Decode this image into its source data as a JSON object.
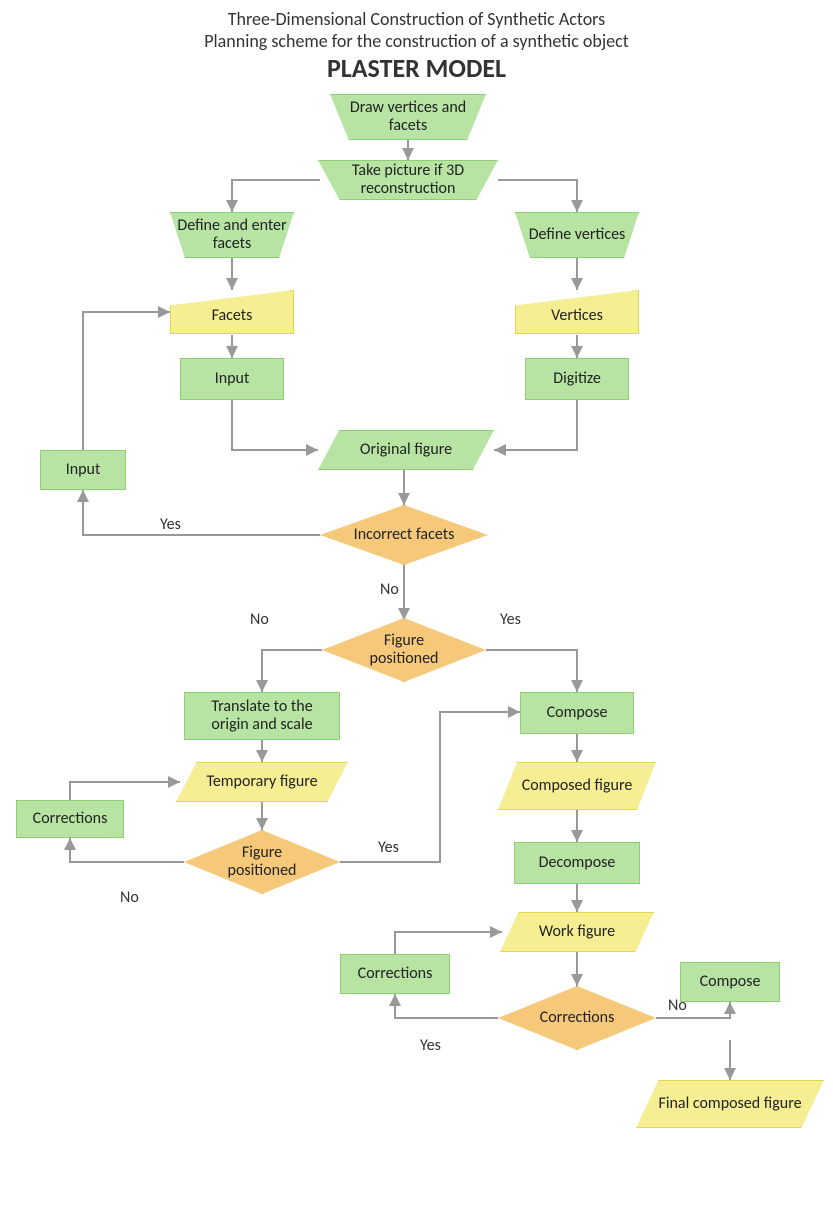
{
  "titles": {
    "line1": "Three-Dimensional Construction of Synthetic Actors",
    "line2": "Planning scheme for the construction of a synthetic object",
    "main": "PLASTER MODEL"
  },
  "nodes": {
    "draw": "Draw vertices and facets",
    "takepic": "Take picture if 3D reconstruction",
    "deffacets": "Define and enter facets",
    "defverts": "Define vertices",
    "facets": "Facets",
    "vertices": "Vertices",
    "inputL": "Input",
    "digitize": "Digitize",
    "inputLoop": "Input",
    "origfig": "Original figure",
    "incfacets": "Incorrect facets",
    "figpos1": "Figure positioned",
    "translate": "Translate to the origin and scale",
    "tempfig": "Temporary figure",
    "figpos2": "Figure positioned",
    "correctionsL": "Corrections",
    "compose1": "Compose",
    "compfig": "Composed figure",
    "decompose": "Decompose",
    "workfig": "Work figure",
    "correctionsR": "Corrections",
    "correctionsDec": "Corrections",
    "compose2": "Compose",
    "finalfig": "Final composed figure"
  },
  "labels": {
    "yes": "Yes",
    "no": "No"
  },
  "chart_data": {
    "type": "flowchart",
    "title": "PLASTER MODEL — Planning scheme for the construction of a synthetic object",
    "nodes": [
      {
        "id": "draw",
        "shape": "manual-op",
        "label": "Draw vertices and facets"
      },
      {
        "id": "takepic",
        "shape": "manual-op",
        "label": "Take picture if 3D reconstruction"
      },
      {
        "id": "deffacets",
        "shape": "manual-op",
        "label": "Define and enter facets"
      },
      {
        "id": "defverts",
        "shape": "manual-op",
        "label": "Define vertices"
      },
      {
        "id": "facets",
        "shape": "manual-input",
        "label": "Facets"
      },
      {
        "id": "vertices",
        "shape": "manual-input",
        "label": "Vertices"
      },
      {
        "id": "inputL",
        "shape": "process",
        "label": "Input"
      },
      {
        "id": "digitize",
        "shape": "process",
        "label": "Digitize"
      },
      {
        "id": "inputLoop",
        "shape": "process",
        "label": "Input"
      },
      {
        "id": "origfig",
        "shape": "data",
        "label": "Original figure"
      },
      {
        "id": "incfacets",
        "shape": "decision",
        "label": "Incorrect facets"
      },
      {
        "id": "figpos1",
        "shape": "decision",
        "label": "Figure positioned"
      },
      {
        "id": "translate",
        "shape": "process",
        "label": "Translate to the origin and scale"
      },
      {
        "id": "tempfig",
        "shape": "data",
        "label": "Temporary figure"
      },
      {
        "id": "figpos2",
        "shape": "decision",
        "label": "Figure positioned"
      },
      {
        "id": "correctionsL",
        "shape": "process",
        "label": "Corrections"
      },
      {
        "id": "compose1",
        "shape": "process",
        "label": "Compose"
      },
      {
        "id": "compfig",
        "shape": "data",
        "label": "Composed figure"
      },
      {
        "id": "decompose",
        "shape": "process",
        "label": "Decompose"
      },
      {
        "id": "workfig",
        "shape": "data",
        "label": "Work figure"
      },
      {
        "id": "correctionsR",
        "shape": "process",
        "label": "Corrections"
      },
      {
        "id": "correctionsDec",
        "shape": "decision",
        "label": "Corrections"
      },
      {
        "id": "compose2",
        "shape": "process",
        "label": "Compose"
      },
      {
        "id": "finalfig",
        "shape": "data",
        "label": "Final composed figure"
      }
    ],
    "edges": [
      {
        "from": "draw",
        "to": "takepic"
      },
      {
        "from": "takepic",
        "to": "deffacets"
      },
      {
        "from": "takepic",
        "to": "defverts"
      },
      {
        "from": "deffacets",
        "to": "facets"
      },
      {
        "from": "defverts",
        "to": "vertices"
      },
      {
        "from": "facets",
        "to": "inputL"
      },
      {
        "from": "vertices",
        "to": "digitize"
      },
      {
        "from": "inputL",
        "to": "origfig"
      },
      {
        "from": "digitize",
        "to": "origfig"
      },
      {
        "from": "origfig",
        "to": "incfacets"
      },
      {
        "from": "incfacets",
        "to": "inputLoop",
        "label": "Yes"
      },
      {
        "from": "inputLoop",
        "to": "facets"
      },
      {
        "from": "incfacets",
        "to": "figpos1",
        "label": "No"
      },
      {
        "from": "figpos1",
        "to": "translate",
        "label": "No"
      },
      {
        "from": "figpos1",
        "to": "compose1",
        "label": "Yes"
      },
      {
        "from": "translate",
        "to": "tempfig"
      },
      {
        "from": "tempfig",
        "to": "figpos2"
      },
      {
        "from": "figpos2",
        "to": "correctionsL",
        "label": "No"
      },
      {
        "from": "correctionsL",
        "to": "tempfig"
      },
      {
        "from": "figpos2",
        "to": "compose1",
        "label": "Yes"
      },
      {
        "from": "compose1",
        "to": "compfig"
      },
      {
        "from": "compfig",
        "to": "decompose"
      },
      {
        "from": "decompose",
        "to": "workfig"
      },
      {
        "from": "workfig",
        "to": "correctionsDec"
      },
      {
        "from": "correctionsDec",
        "to": "correctionsR",
        "label": "Yes"
      },
      {
        "from": "correctionsR",
        "to": "workfig"
      },
      {
        "from": "correctionsDec",
        "to": "compose2",
        "label": "No"
      },
      {
        "from": "compose2",
        "to": "finalfig"
      }
    ]
  }
}
